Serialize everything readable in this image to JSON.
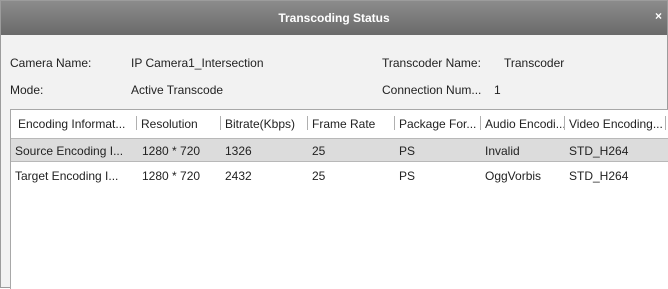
{
  "window": {
    "title": "Transcoding Status",
    "close_glyph": "×"
  },
  "info": {
    "camera_name_label": "Camera Name:",
    "camera_name_value": "IP Camera1_Intersection",
    "transcoder_name_label": "Transcoder Name:",
    "transcoder_name_value": "Transcoder",
    "mode_label": "Mode:",
    "mode_value": "Active Transcode",
    "connection_num_label": "Connection Num...",
    "connection_num_value": "1"
  },
  "table": {
    "columns": [
      "Encoding Informat...",
      "Resolution",
      "Bitrate(Kbps)",
      "Frame Rate",
      "Package For...",
      "Audio Encodi...",
      "Video Encoding..."
    ],
    "rows": [
      [
        "Source Encoding I...",
        "1280 * 720",
        "1326",
        "25",
        "PS",
        "Invalid",
        "STD_H264"
      ],
      [
        "Target Encoding I...",
        "1280 * 720",
        "2432",
        "25",
        "PS",
        "OggVorbis",
        "STD_H264"
      ]
    ],
    "selected_row": 0
  }
}
